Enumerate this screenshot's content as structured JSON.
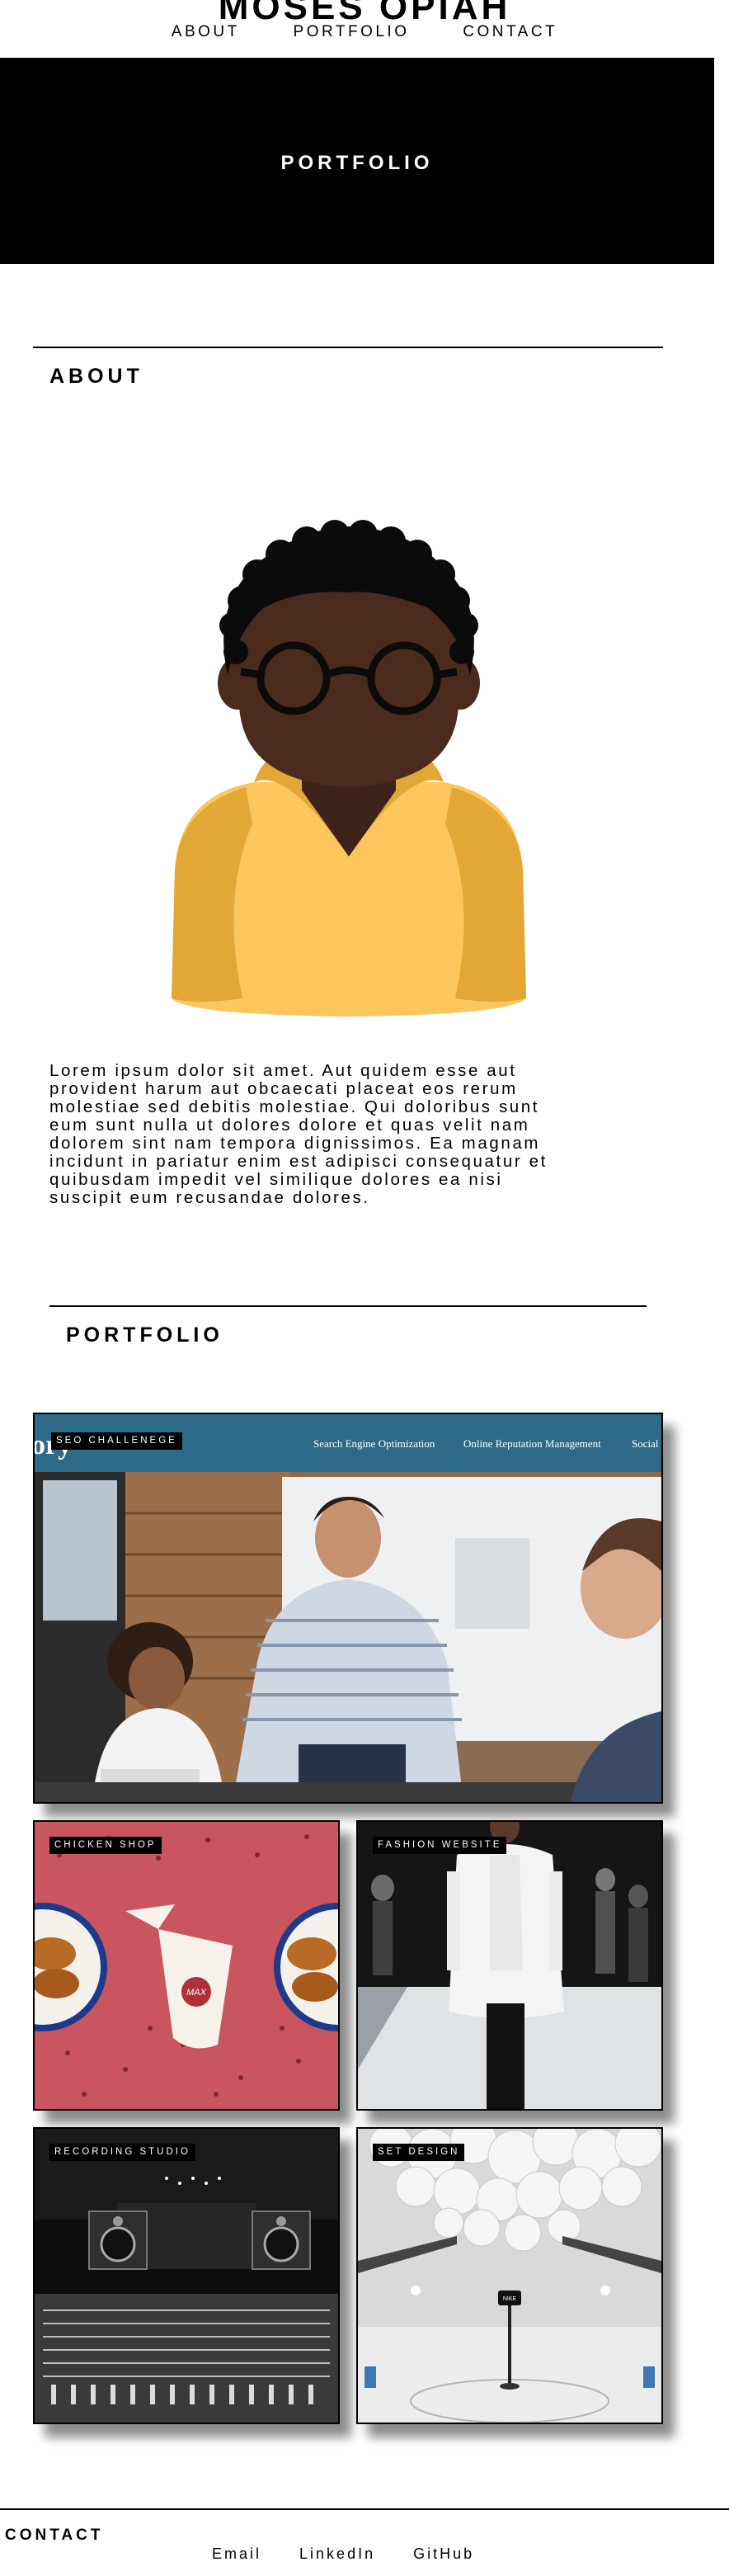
{
  "header": {
    "site_title": "MOSES OPIAH",
    "nav": [
      "ABOUT",
      "PORTFOLIO",
      "CONTACT"
    ]
  },
  "hero": {
    "label": "PORTFOLIO"
  },
  "about": {
    "heading": "ABOUT",
    "lines": [
      "Lorem ipsum dolor sit amet. Aut quidem esse aut",
      "provident harum aut obcaecati placeat eos rerum",
      "molestiae sed debitis molestiae. Qui doloribus sunt",
      "eum sunt nulla ut dolores dolore et quas velit nam",
      "dolorem sint nam tempora dignissimos. Ea magnam",
      "incidunt in pariatur enim est adipisci consequatur et",
      "quibusdam impedit vel similique dolores ea nisi",
      "suscipit eum recusandae dolores."
    ]
  },
  "portfolio": {
    "heading": "PORTFOLIO",
    "projects": [
      {
        "label": "SEO CHALLENEGE",
        "brand_fragment": "ory",
        "site_nav": [
          "Search Engine Optimization",
          "Online Reputation Management",
          "Social"
        ]
      },
      {
        "label": "CHICKEN SHOP",
        "wrapper_text": "MAX"
      },
      {
        "label": "FASHION WEBSITE"
      },
      {
        "label": "RECORDING STUDIO"
      },
      {
        "label": "SET DESIGN",
        "sign_text": "NIKE"
      }
    ]
  },
  "footer": {
    "heading": "CONTACT",
    "links": [
      "Email",
      "LinkedIn",
      "GitHub"
    ]
  },
  "colors": {
    "hero_bg": "#000000",
    "skin": "#4a2b1e",
    "shirt": "#fdc65d",
    "shirt_shade": "#e2a735",
    "seo_nav_bar": "#2e6a87",
    "chicken_bg": "#c9555e"
  }
}
